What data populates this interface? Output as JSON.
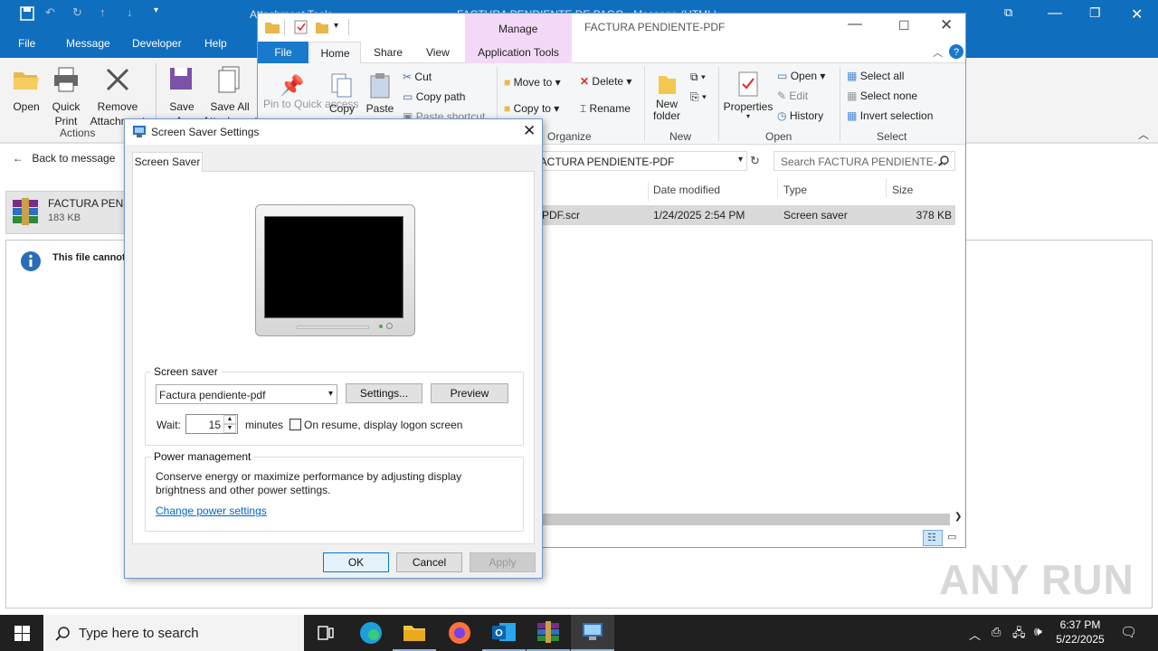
{
  "outlook": {
    "titlebar": {
      "context_tab": "Attachment Tools",
      "title": "FACTURA PENDIENTE DE PAGO - Message (HTML)"
    },
    "tabs": [
      "File",
      "Message",
      "Developer",
      "Help"
    ],
    "ribbon": {
      "open": "Open",
      "quick_print": "Quick Print",
      "remove": "Remove Attachment",
      "save_as": "Save As",
      "save_all": "Save All Attachments",
      "actions_group": "Actions"
    },
    "back": "Back to message",
    "attachment": {
      "name": "FACTURA PENDIENTE-PDF.rar",
      "size": "183 KB"
    },
    "info": "This file cannot be previewed."
  },
  "explorer": {
    "title": "FACTURA PENDIENTE-PDF",
    "manage": "Manage",
    "tabs": [
      "File",
      "Home",
      "Share",
      "View",
      "Application Tools"
    ],
    "clipboard": {
      "pin": "Pin to Quick access",
      "copy": "Copy",
      "paste": "Paste",
      "cut": "Cut",
      "copy_path": "Copy path",
      "paste_shortcut": "Paste shortcut"
    },
    "organize": {
      "move": "Move to",
      "copy": "Copy to",
      "delete": "Delete",
      "rename": "Rename",
      "label": "Organize"
    },
    "new": {
      "folder": "New folder",
      "label": "New"
    },
    "open": {
      "properties": "Properties",
      "open": "Open",
      "edit": "Edit",
      "history": "History",
      "label": "Open"
    },
    "select": {
      "all": "Select all",
      "none": "Select none",
      "invert": "Invert selection",
      "label": "Select"
    },
    "address": "FACTURA PENDIENTE-PDF",
    "search_placeholder": "Search FACTURA PENDIENTE-...",
    "columns": [
      "Date modified",
      "Type",
      "Size"
    ],
    "row": {
      "name": "PDF.scr",
      "date": "1/24/2025 2:54 PM",
      "type": "Screen saver",
      "size": "378 KB"
    }
  },
  "dialog": {
    "title": "Screen Saver Settings",
    "tab": "Screen Saver",
    "ss_group": "Screen saver",
    "ss_value": "Factura pendiente-pdf",
    "settings": "Settings...",
    "preview": "Preview",
    "wait": "Wait:",
    "wait_value": "15",
    "minutes": "minutes",
    "resume": "On resume, display logon screen",
    "power_group": "Power management",
    "power_text": "Conserve energy or maximize performance by adjusting display brightness and other power settings.",
    "power_link": "Change power settings",
    "ok": "OK",
    "cancel": "Cancel",
    "apply": "Apply"
  },
  "taskbar": {
    "search": "Type here to search",
    "time": "6:37 PM",
    "date": "5/22/2025"
  },
  "watermark": "ANY RUN"
}
